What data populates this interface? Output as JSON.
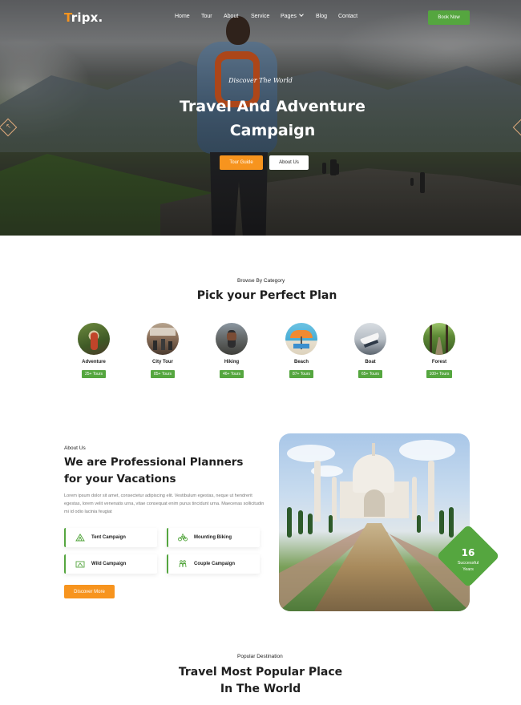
{
  "nav": {
    "logo_accent": "T",
    "logo_rest": "ripx.",
    "items": [
      "Home",
      "Tour",
      "About",
      "Service",
      "Pages",
      "Blog",
      "Contact"
    ],
    "cta": "Book Now"
  },
  "hero": {
    "subtitle": "Discover The World",
    "title_line1": "Travel And Adventure",
    "title_line2": "Campaign",
    "primary_button": "Tour Guide",
    "secondary_button": "About Us"
  },
  "categories": {
    "eyebrow_highlight": "Browse",
    "eyebrow_rest": " By Category",
    "title": "Pick your Perfect Plan",
    "items": [
      {
        "name": "Adventure",
        "count": "25+ Tours"
      },
      {
        "name": "City Tour",
        "count": "85+ Tours"
      },
      {
        "name": "Hiking",
        "count": "46+ Tours"
      },
      {
        "name": "Beach",
        "count": "87+ Tours"
      },
      {
        "name": "Boat",
        "count": "65+ Tours"
      },
      {
        "name": "Forest",
        "count": "100+ Tours"
      }
    ]
  },
  "about": {
    "eyebrow_highlight": "About U",
    "eyebrow_rest": "s",
    "title_line1": "We are Professional Planners",
    "title_line2": "for your Vacations",
    "body": "Lorem ipsum dolor sit amet, consectetur adipiscing elit. Vestibulum egestas, neque ut hendrerit egestas, lorem velit venenatis urna, vitae consequat enim purus tincidunt urna. Maecenas sollicitudin mi id odio lacinia feugiat",
    "features": [
      "Tent Campaign",
      "Mounting Biking",
      "Wild Campaign",
      "Couple Campaign"
    ],
    "button": "Discover More",
    "years_number": "16",
    "years_label_1": "Successful",
    "years_label_2": "Years"
  },
  "popular": {
    "eyebrow_highlight": "Popular",
    "eyebrow_rest": " Destination",
    "title_line1": "Travel Most Popular Place",
    "title_line2": "In The World"
  },
  "colors": {
    "accent_orange": "#f7941e",
    "accent_green": "#55a63f",
    "heading": "#1e1e1e"
  },
  "icons": [
    "arrow-prev-icon",
    "arrow-next-icon",
    "chevron-down-icon",
    "tent-icon",
    "bike-icon",
    "campfire-icon",
    "couple-icon"
  ]
}
